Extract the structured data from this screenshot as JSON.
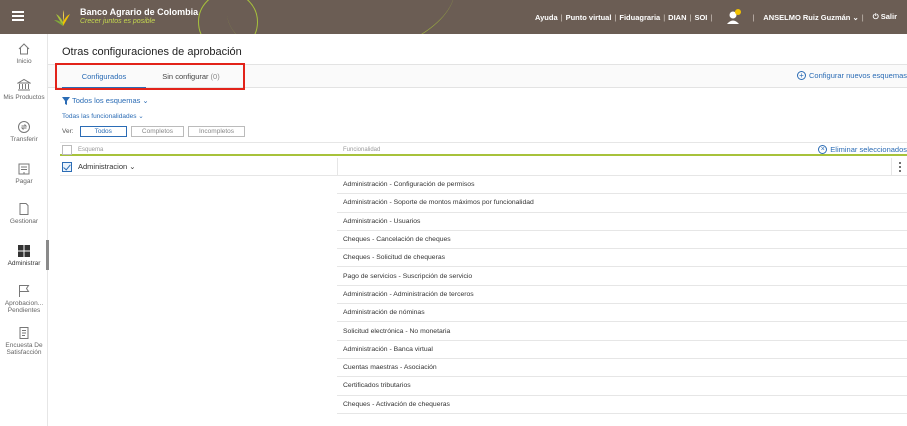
{
  "header": {
    "brand_name": "Banco Agrario de Colombia",
    "brand_tagline": "Crecer juntos es posible",
    "links": [
      "Ayuda",
      "Punto virtual",
      "Fiduagraria",
      "DIAN",
      "SOI"
    ],
    "user_name": "ANSELMO Ruiz Guzmán ⌄",
    "logout_label": "Salir"
  },
  "sidebar": {
    "items": [
      {
        "label": "Inicio",
        "icon": "home-icon"
      },
      {
        "label": "Mis Productos",
        "icon": "bank-icon"
      },
      {
        "label": "Transferir",
        "icon": "transfer-icon"
      },
      {
        "label": "Pagar",
        "icon": "pay-icon"
      },
      {
        "label": "Gestionar",
        "icon": "manage-icon"
      },
      {
        "label": "Administrar",
        "icon": "admin-grid-icon"
      },
      {
        "label": "Aprobacion... Pendientes",
        "icon": "flag-icon"
      },
      {
        "label": "Encuesta De Satisfacción",
        "icon": "survey-icon"
      }
    ]
  },
  "main": {
    "title": "Otras configuraciones de aprobación",
    "tabs": [
      {
        "label": "Configurados"
      },
      {
        "label": "Sin configurar",
        "count": "(0)"
      }
    ],
    "configure_new_label": "Configurar nuevos esquemas",
    "filter_schemes_label": "Todos los esquemas",
    "filter_functions_label": "Todas las funcionalidades",
    "view_label": "Ver:",
    "view_options": [
      "Todos",
      "Completos",
      "Incompletos"
    ],
    "table": {
      "col_scheme": "Esquema",
      "col_function": "Funcionalidad",
      "delete_selected_label": "Eliminar seleccionados",
      "group_name": "Administracion",
      "functions": [
        "Administración - Configuración de permisos",
        "Administración - Soporte de montos máximos por funcionalidad",
        "Administración - Usuarios",
        "Cheques - Cancelación de cheques",
        "Cheques - Solicitud de chequeras",
        "Pago de servicios - Suscripción de servicio",
        "Administración - Administración de terceros",
        "Administración de nóminas",
        "Solicitud electrónica - No monetaria",
        "Administración - Banca virtual",
        "Cuentas maestras - Asociación",
        "Certificados tributarios",
        "Cheques - Activación de chequeras"
      ]
    }
  },
  "colors": {
    "topbar": "#6b5d54",
    "accent_green": "#a7c23b",
    "link_blue": "#2b6cb5",
    "highlight_red": "#e2231a"
  }
}
